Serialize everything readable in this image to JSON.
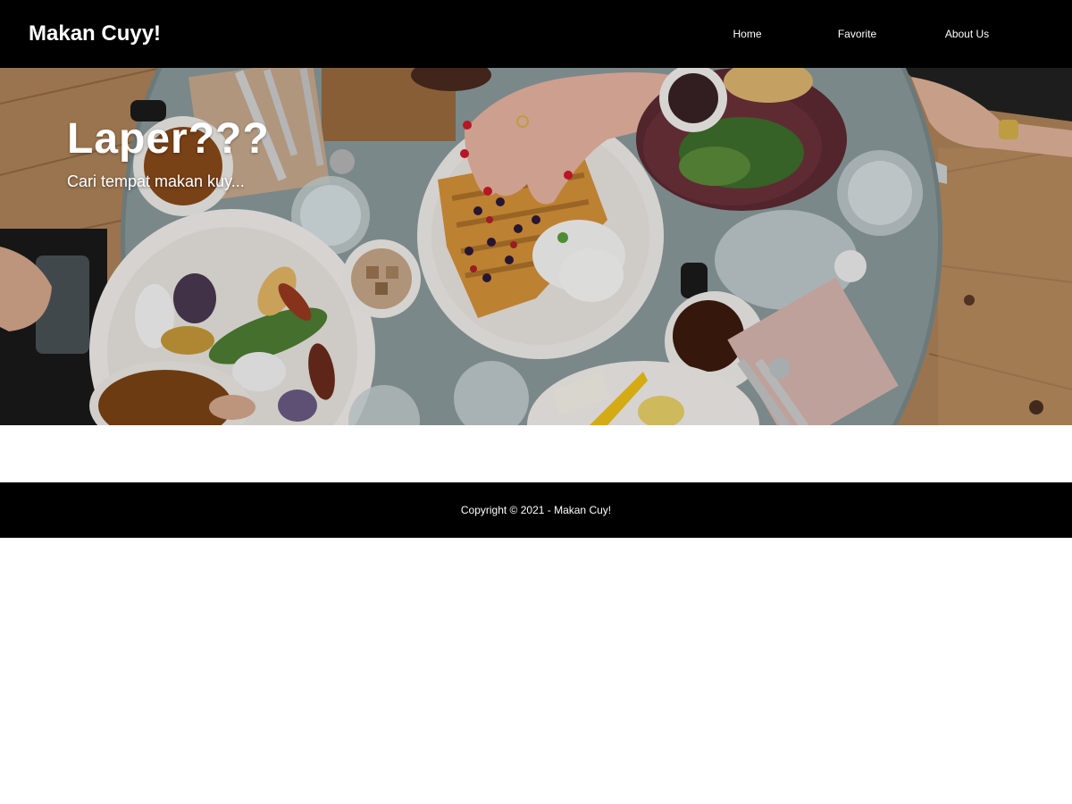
{
  "navbar": {
    "brand": "Makan Cuyy!",
    "links": [
      {
        "label": "Home"
      },
      {
        "label": "Favorite"
      },
      {
        "label": "About Us"
      }
    ]
  },
  "hero": {
    "title": "Laper???",
    "subtitle": "Cari tempat makan kuy..."
  },
  "footer": {
    "copyright": "Copyright © 2021 - Makan Cuy!"
  },
  "colors": {
    "navbar_bg": "#000000",
    "footer_bg": "#000000",
    "text_on_dark": "#ffffff",
    "page_bg": "#ffffff"
  }
}
